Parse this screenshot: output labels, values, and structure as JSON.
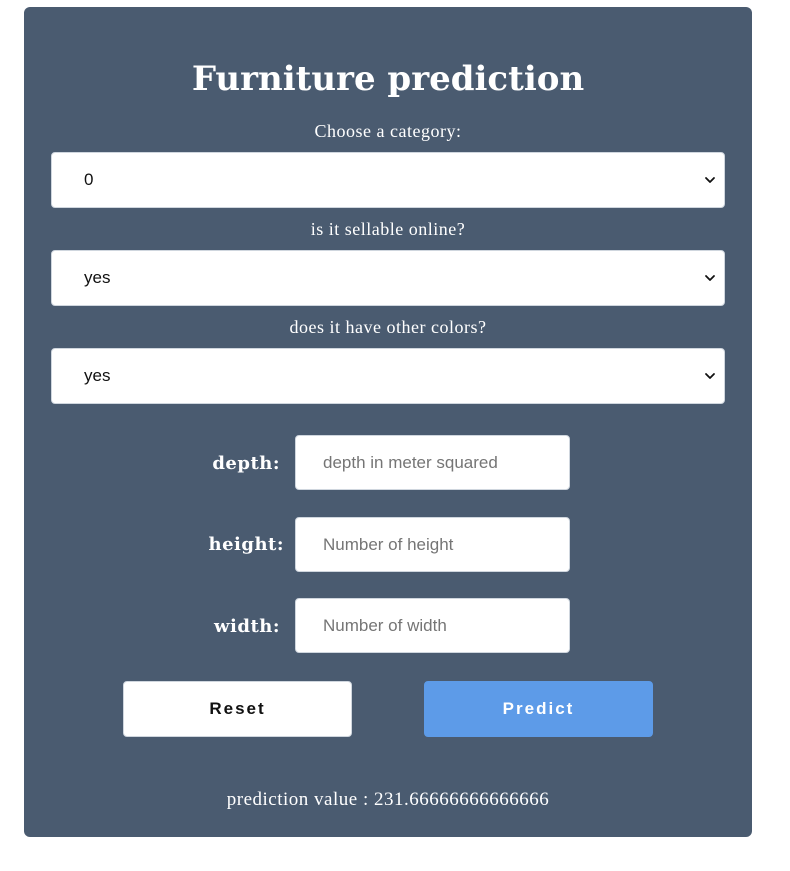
{
  "app": {
    "title": "Furniture prediction"
  },
  "form": {
    "category": {
      "label": "Choose a category:",
      "selected": "0"
    },
    "sellable_online": {
      "label": "is it sellable online?",
      "selected": "yes"
    },
    "other_colors": {
      "label": "does it have other colors?",
      "selected": "yes"
    },
    "depth": {
      "label": "depth:",
      "value": "",
      "placeholder": "depth in meter squared"
    },
    "height": {
      "label": "height:",
      "value": "",
      "placeholder": "Number of height"
    },
    "width": {
      "label": "width:",
      "value": "",
      "placeholder": "Number of width"
    },
    "buttons": {
      "reset_label": "Reset",
      "predict_label": "Predict"
    }
  },
  "result": {
    "text": "prediction value : 231.66666666666666"
  },
  "colors": {
    "card_background": "#4a5b70",
    "accent_button": "#5d9be8",
    "text_on_card": "#ffffff"
  },
  "icons": {
    "select_arrow": "chevron-down-icon"
  }
}
